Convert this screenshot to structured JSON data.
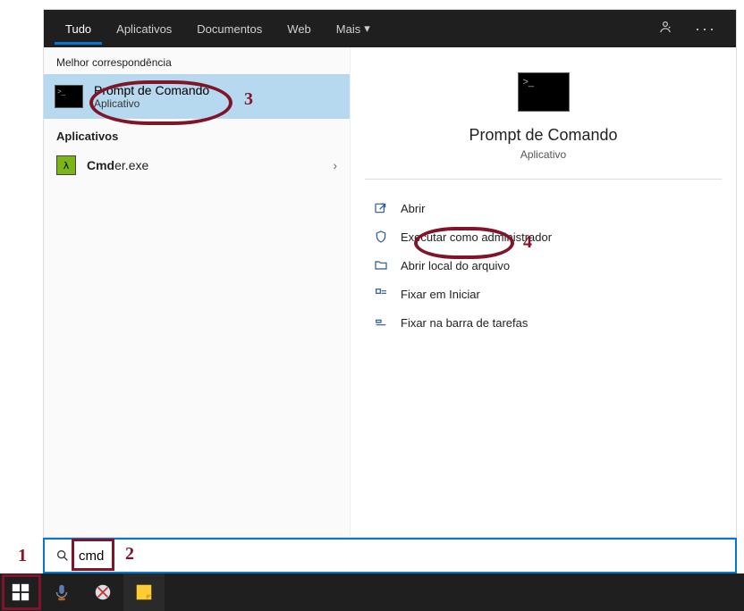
{
  "tabs": {
    "tudo": "Tudo",
    "apps": "Aplicativos",
    "docs": "Documentos",
    "web": "Web",
    "mais": "Mais"
  },
  "left": {
    "best_header": "Melhor correspondência",
    "best_title": "Prompt de Comando",
    "best_sub": "Aplicativo",
    "apps_header": "Aplicativos",
    "cmder_pre": "Cmd",
    "cmder_post": "er.exe"
  },
  "preview": {
    "title": "Prompt de Comando",
    "sub": "Aplicativo"
  },
  "actions": {
    "open": "Abrir",
    "admin": "Executar como administrador",
    "location": "Abrir local do arquivo",
    "pin_start": "Fixar em Iniciar",
    "pin_taskbar": "Fixar na barra de tarefas"
  },
  "search": {
    "value": "cmd"
  },
  "annotations": {
    "n1": "1",
    "n2": "2",
    "n3": "3",
    "n4": "4"
  }
}
